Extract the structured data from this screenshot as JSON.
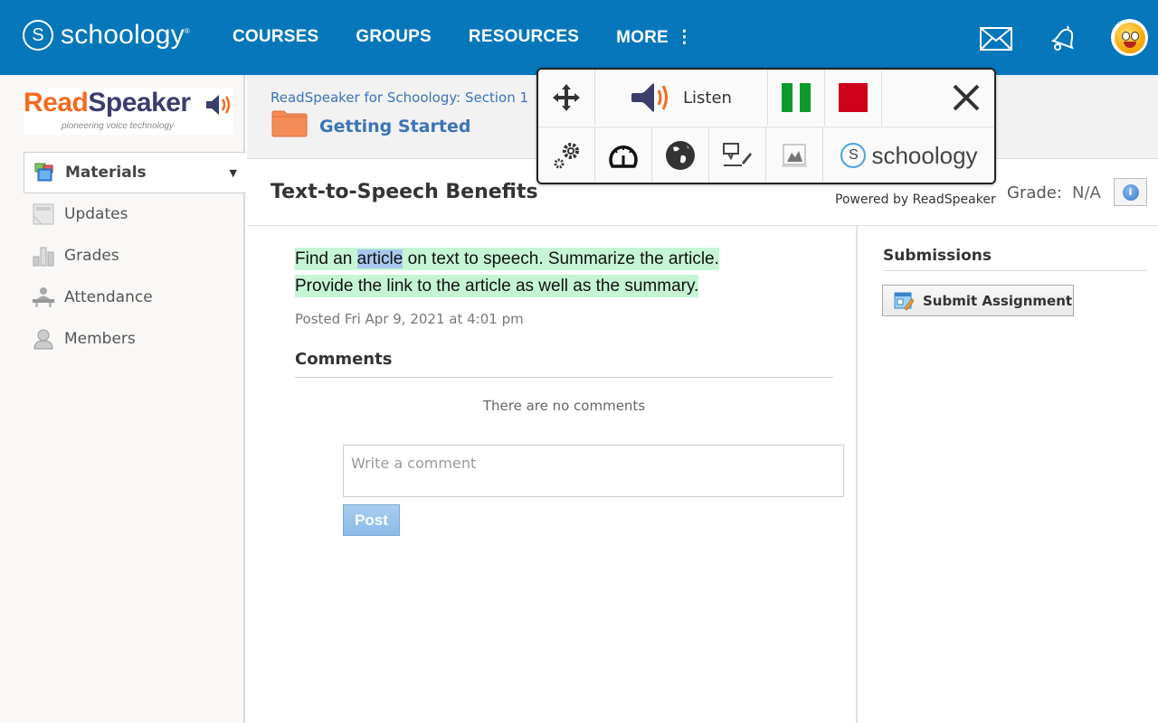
{
  "app": {
    "brand": "schoology",
    "brand_letter": "S"
  },
  "topnav": {
    "links": [
      {
        "label": "COURSES"
      },
      {
        "label": "GROUPS"
      },
      {
        "label": "RESOURCES"
      },
      {
        "label": "MORE",
        "icon": "kebab-vertical-icon"
      }
    ],
    "more_glyph": "⋮",
    "icons": [
      "mail-icon",
      "bell-icon",
      "avatar"
    ]
  },
  "sidebar": {
    "logo": {
      "part1": "Read",
      "part2": "Speaker",
      "tagline": "pioneering voice technology",
      "colors": {
        "read": "#f26b21",
        "speaker": "#3b3d6b"
      }
    },
    "items": [
      {
        "label": "Materials",
        "icon": "materials-icon",
        "active": true,
        "caret": "▼"
      },
      {
        "label": "Updates",
        "icon": "updates-icon",
        "active": false
      },
      {
        "label": "Grades",
        "icon": "grades-icon",
        "active": false
      },
      {
        "label": "Attendance",
        "icon": "attendance-icon",
        "active": false
      },
      {
        "label": "Members",
        "icon": "members-icon",
        "active": false
      }
    ]
  },
  "header": {
    "breadcrumb": "ReadSpeaker for Schoology: Section 1",
    "folder_title": "Getting Started"
  },
  "assignment": {
    "title": "Text-to-Speech Benefits",
    "powered_by": "Powered by ReadSpeaker",
    "grade_label": "Grade:",
    "grade_value": "N/A",
    "body_line1_before": "Find an ",
    "body_line1_highlight": "article",
    "body_line1_after": " on text to speech.  Summarize the article.",
    "body_line2": "Provide the link to the article as well as the summary.",
    "posted": "Posted Fri Apr 9, 2021 at 4:01 pm"
  },
  "comments": {
    "heading": "Comments",
    "empty_text": "There are no comments",
    "input_placeholder": "Write a comment",
    "input_value": "",
    "post_label": "Post"
  },
  "submissions": {
    "heading": "Submissions",
    "submit_label": "Submit Assignment"
  },
  "readspeaker_toolbar": {
    "listen_label": "Listen",
    "brand": "schoology",
    "brand_letter": "S",
    "colors": {
      "pause": "#0a9a2d",
      "stop": "#d0021b",
      "speaker": "#3b3d6b",
      "waves": "#f26b21"
    },
    "buttons_row1": [
      "move-icon",
      "listen-button",
      "pause-button",
      "stop-button",
      "close-button"
    ],
    "buttons_row2": [
      "settings-icon",
      "speed-icon",
      "globe-icon",
      "text-mode-icon",
      "image-icon",
      "schoology-brand"
    ]
  }
}
